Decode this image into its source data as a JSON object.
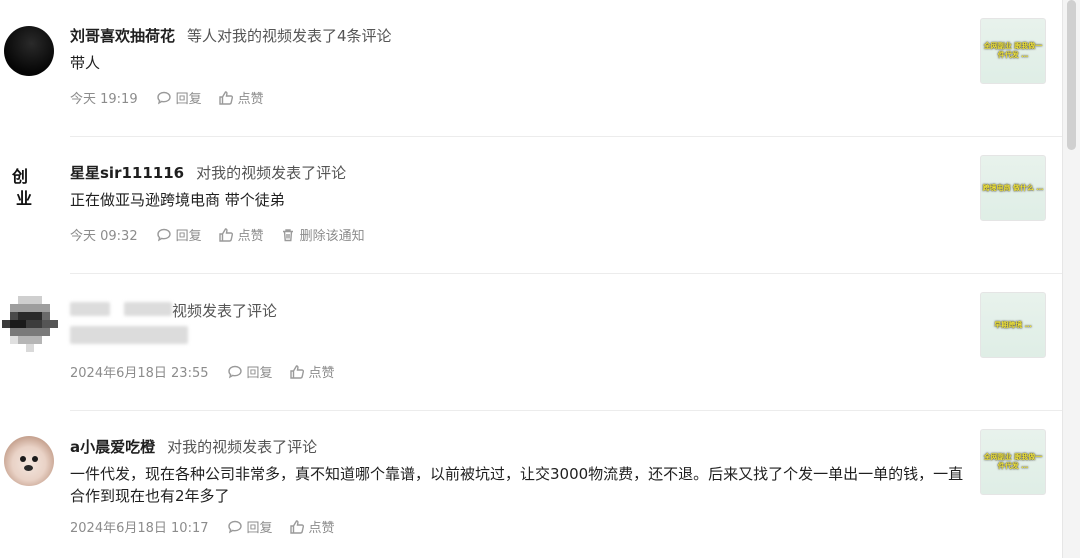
{
  "notifications": [
    {
      "username": "刘哥喜欢抽荷花",
      "action": "等人对我的视频发表了4条评论",
      "content": "带人",
      "time": "今天 19:19",
      "reply_label": "回复",
      "like_label": "点赞",
      "thumb_text": "全网副业 跟我做一件代发 …"
    },
    {
      "username": "星星sir111116",
      "avatar_text": [
        "创",
        "业"
      ],
      "action": "对我的视频发表了评论",
      "content": "正在做亚马逊跨境电商 带个徒弟",
      "time": "今天 09:32",
      "reply_label": "回复",
      "like_label": "点赞",
      "delete_label": "删除该通知",
      "thumb_text": "跨境电商 做什么 …"
    },
    {
      "username": "",
      "action": "视频发表了评论",
      "content": "",
      "time": "2024年6月18日 23:55",
      "reply_label": "回复",
      "like_label": "点赞",
      "thumb_text": "早期跨境 …"
    },
    {
      "username": "a小晨爱吃橙",
      "action": "对我的视频发表了评论",
      "content": "一件代发，现在各种公司非常多，真不知道哪个靠谱，以前被坑过，让交3000物流费，还不退。后来又找了个发一单出一单的钱，一直合作到现在也有2年多了",
      "time": "2024年6月18日 10:17",
      "reply_label": "回复",
      "like_label": "点赞",
      "thumb_text": "全网副业 跟我做一件代发 …"
    }
  ]
}
